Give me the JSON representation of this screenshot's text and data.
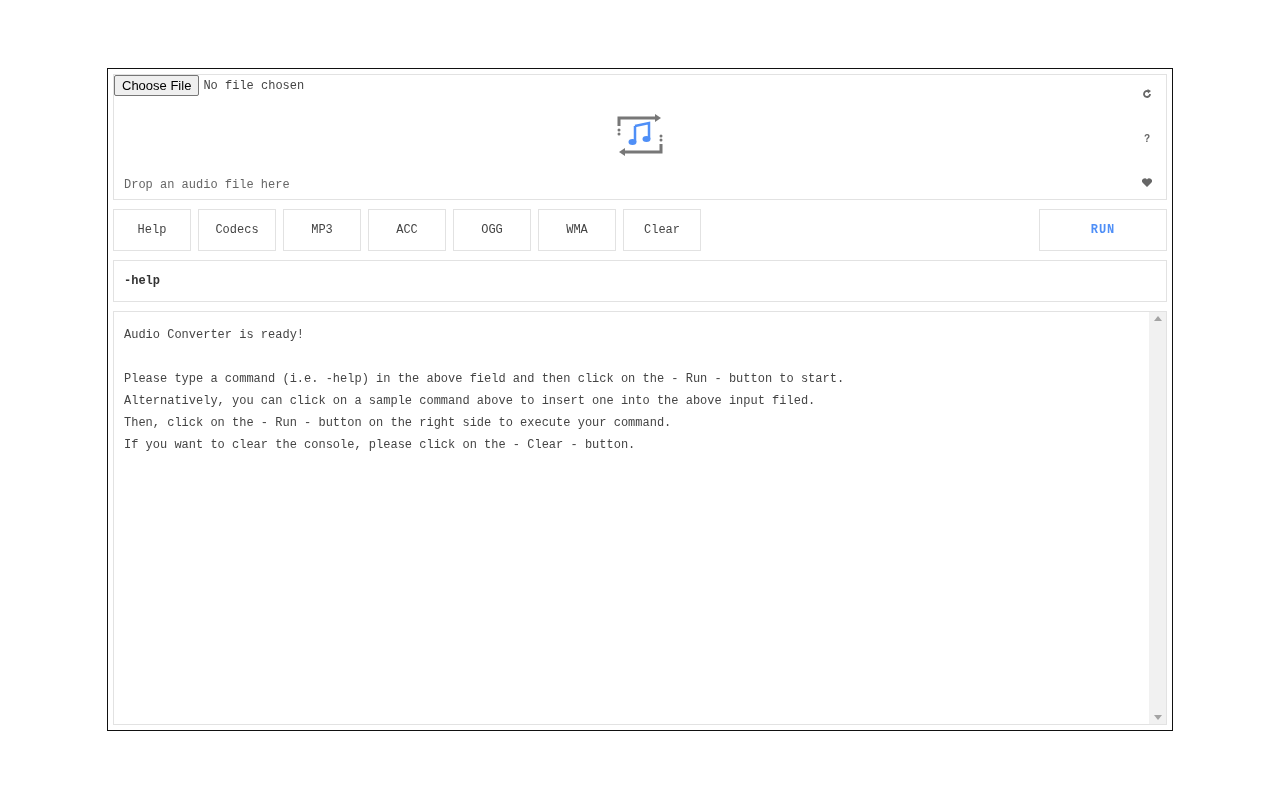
{
  "file_picker": {
    "button": "Choose File",
    "status": "No file chosen"
  },
  "drop_zone": {
    "hint": "Drop an audio file here",
    "help_glyph": "?"
  },
  "samples": [
    {
      "label": "Help"
    },
    {
      "label": "Codecs"
    },
    {
      "label": "MP3"
    },
    {
      "label": "ACC"
    },
    {
      "label": "OGG"
    },
    {
      "label": "WMA"
    },
    {
      "label": "Clear"
    }
  ],
  "run_button": "RUN",
  "command": {
    "value": "-help"
  },
  "console": {
    "status": "Audio Converter is ready!",
    "lines": [
      "Please type a command (i.e. -help) in the above field and then click on the - Run - button to start.",
      "Alternatively, you can click on a sample command above to insert one into the above input filed.",
      "Then, click on the - Run - button on the right side to execute your command.",
      "If you want to clear the console, please click on the - Clear - button."
    ]
  }
}
